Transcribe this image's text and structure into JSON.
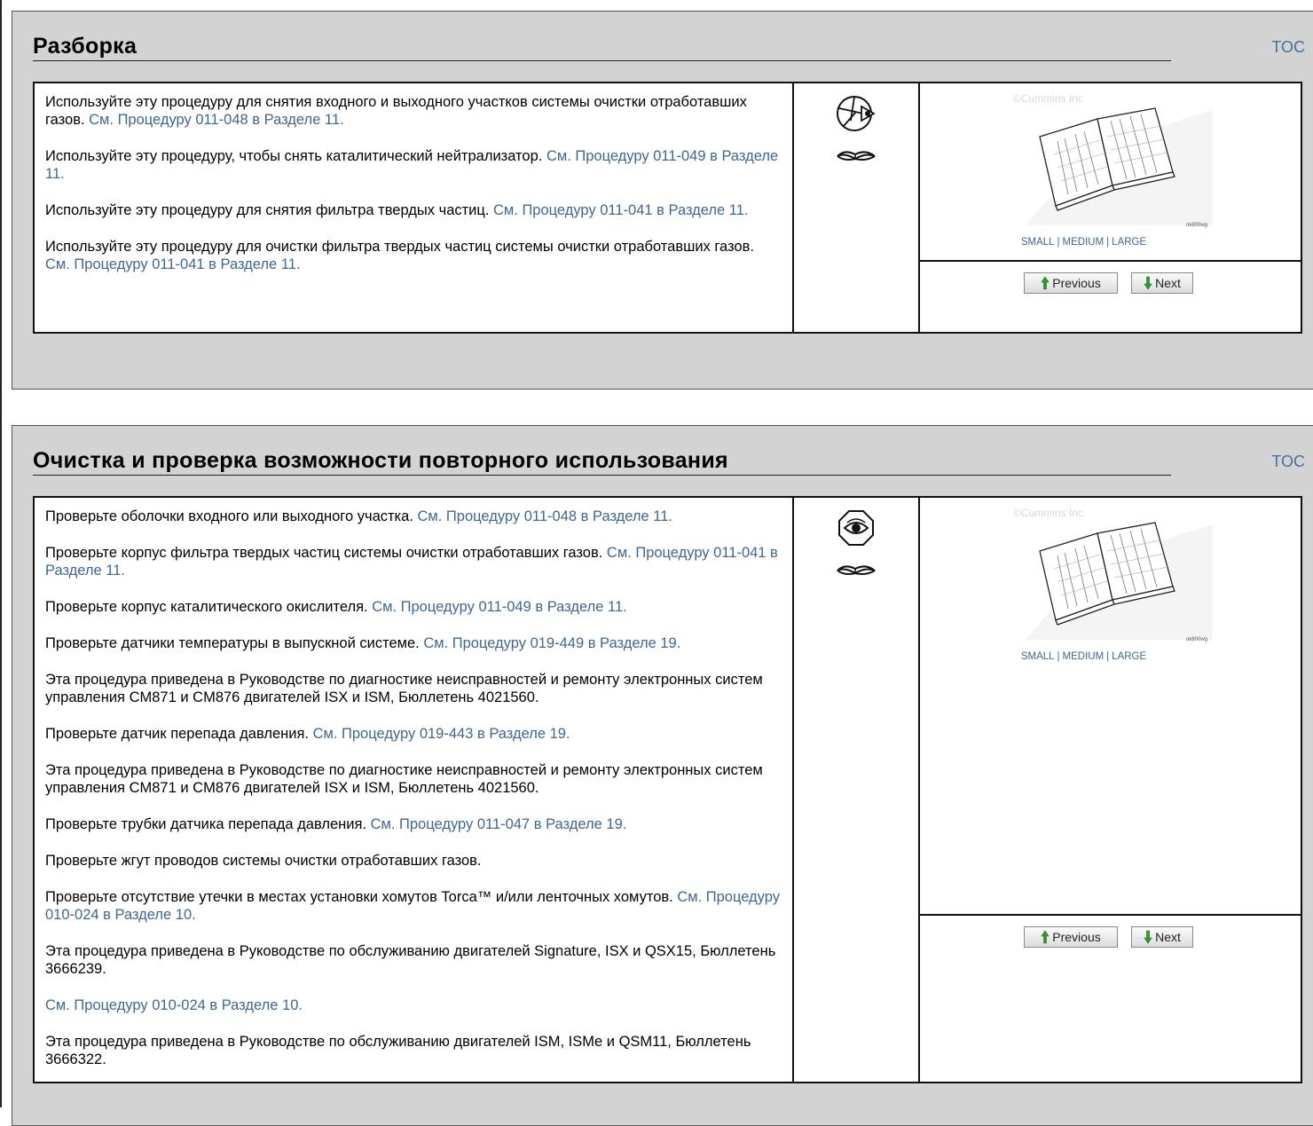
{
  "sections": [
    {
      "title": "Разборка",
      "toc": "TOC",
      "paragraphs": [
        {
          "text": "Используйте эту процедуру для снятия входного и выходного участков системы очистки отработавших газов. ",
          "link": "См. Процедуру 011-048 в Разделе 11."
        },
        {
          "text": "Используйте эту процедуру, чтобы снять каталитический нейтрализатор. ",
          "link": "См. Процедуру 011-049 в Разделе 11."
        },
        {
          "text": "Используйте эту процедуру для снятия фильтра твердых частиц. ",
          "link": "См. Процедуру 011-041 в Разделе 11."
        },
        {
          "text": "Используйте эту процедуру для очистки фильтра твердых частиц системы очистки отработавших газов. ",
          "link": "См. Процедуру 011-041 в Разделе 11."
        }
      ],
      "icons": [
        "wrench-disassembly-icon",
        "manual-book-icon"
      ],
      "image": {
        "copyright": "©Cummins Inc",
        "code": "ok800wg",
        "size_small": "SMALL",
        "size_medium": "MEDIUM",
        "size_large": "LARGE",
        "separator": "|"
      },
      "nav": {
        "previous": "Previous",
        "next": "Next"
      }
    },
    {
      "title": "Очистка и проверка возможности повторного использования",
      "toc": "TOC",
      "paragraphs": [
        {
          "text": "Проверьте оболочки входного или выходного участка. ",
          "link": "См. Процедуру 011-048 в Разделе 11."
        },
        {
          "text": "Проверьте корпус фильтра твердых частиц системы очистки отработавших газов. ",
          "link": "См. Процедуру 011-041 в Разделе 11."
        },
        {
          "text": "Проверьте корпус каталитического окислителя. ",
          "link": "См. Процедуру 011-049 в Разделе 11."
        },
        {
          "text": "Проверьте датчики температуры в выпускной системе. ",
          "link": "См. Процедуру 019-449 в Разделе 19."
        },
        {
          "text": "Эта процедура приведена в Руководстве по диагностике неисправностей и ремонту электронных систем управления CM871 и CM876 двигателей ISX и ISM, Бюллетень 4021560.",
          "link": ""
        },
        {
          "text": "Проверьте датчик перепада давления. ",
          "link": "См. Процедуру 019-443 в Разделе 19."
        },
        {
          "text": "Эта процедура приведена в Руководстве по диагностике неисправностей и ремонту электронных систем управления CM871 и CM876 двигателей ISX и ISM, Бюллетень 4021560.",
          "link": ""
        },
        {
          "text": "Проверьте трубки датчика перепада давления. ",
          "link": "См. Процедуру 011-047 в Разделе 19."
        },
        {
          "text": "Проверьте жгут проводов системы очистки отработавших газов.",
          "link": ""
        },
        {
          "text": "Проверьте отсутствие утечки в местах установки хомутов Torca™ и/или ленточных хомутов. ",
          "link": "См. Процедуру 010-024 в Разделе 10."
        },
        {
          "text": "Эта процедура приведена в Руководстве по обслуживанию двигателей Signature, ISX и QSX15, Бюллетень 3666239.",
          "link": ""
        },
        {
          "text": "",
          "link": "См. Процедуру 010-024 в Разделе 10."
        },
        {
          "text": "Эта процедура приведена в Руководстве по обслуживанию двигателей ISM, ISMe и QSM11, Бюллетень 3666322.",
          "link": ""
        }
      ],
      "icons": [
        "eye-inspect-icon",
        "manual-book-icon"
      ],
      "image": {
        "copyright": "©Cummins Inc",
        "code": "ok800wg",
        "size_small": "SMALL",
        "size_medium": "MEDIUM",
        "size_large": "LARGE",
        "separator": "|"
      },
      "nav": {
        "previous": "Previous",
        "next": "Next"
      }
    }
  ]
}
